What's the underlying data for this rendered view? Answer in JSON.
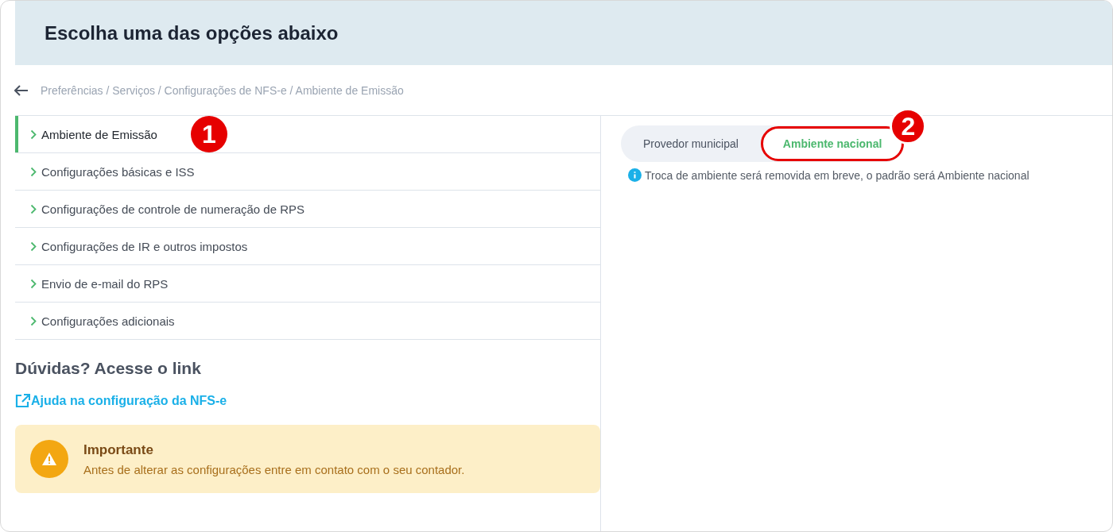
{
  "title": "Escolha uma das opções abaixo",
  "breadcrumb": "Preferências / Serviços / Configurações de NFS-e / Ambiente de Emissão",
  "menu": [
    {
      "label": "Ambiente de Emissão",
      "selected": true
    },
    {
      "label": "Configurações básicas e ISS",
      "selected": false
    },
    {
      "label": "Configurações de controle de numeração de RPS",
      "selected": false
    },
    {
      "label": "Configurações de IR e outros impostos",
      "selected": false
    },
    {
      "label": "Envio de e-mail do RPS",
      "selected": false
    },
    {
      "label": "Configurações adicionais",
      "selected": false
    }
  ],
  "help": {
    "heading": "Dúvidas? Acesse o link",
    "link": "Ajuda na configuração da NFS-e"
  },
  "alert": {
    "title": "Importante",
    "text": "Antes de alterar as configurações entre em contato com o seu contador."
  },
  "toggle": [
    {
      "label": "Provedor municipal",
      "selected": false
    },
    {
      "label": "Ambiente nacional",
      "selected": true
    }
  ],
  "info": "Troca de ambiente será removida em breve, o padrão será Ambiente nacional",
  "markers": [
    "1",
    "2"
  ]
}
